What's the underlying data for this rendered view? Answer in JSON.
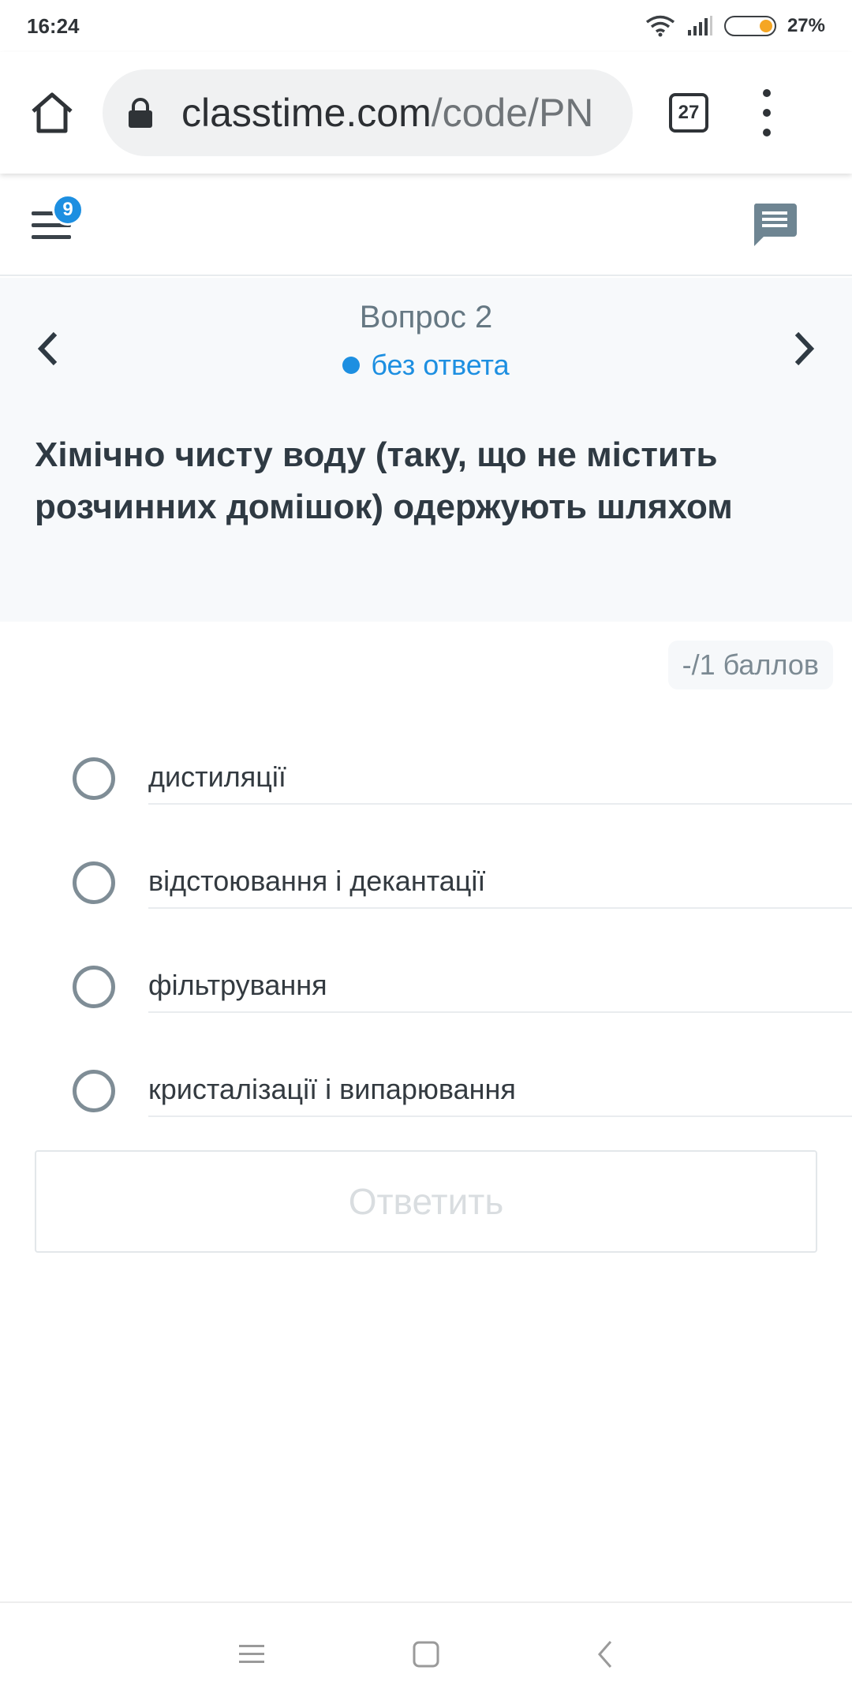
{
  "status_bar": {
    "time": "16:24",
    "battery_percent": "27%",
    "battery_level": 0.27,
    "battery_color": "#f5a623"
  },
  "browser": {
    "url_domain": "classtime.com",
    "url_path": "/code/PN",
    "tab_count": "27"
  },
  "header": {
    "badge_count": "9"
  },
  "question": {
    "number_label": "Вопрос 2",
    "status_label": "без ответа",
    "text": "Хімічно чисту воду (таку, що не містить розчинних домішок) одержують шляхом"
  },
  "points": "-/1 баллов",
  "options": [
    {
      "label": "дистиляції"
    },
    {
      "label": "відстоювання і декантації"
    },
    {
      "label": "фільтрування"
    },
    {
      "label": "кристалізації і випарювання"
    }
  ],
  "submit_label": "Ответить",
  "colors": {
    "accent": "#1d8fe1",
    "panel_bg": "#f7f9fb"
  }
}
